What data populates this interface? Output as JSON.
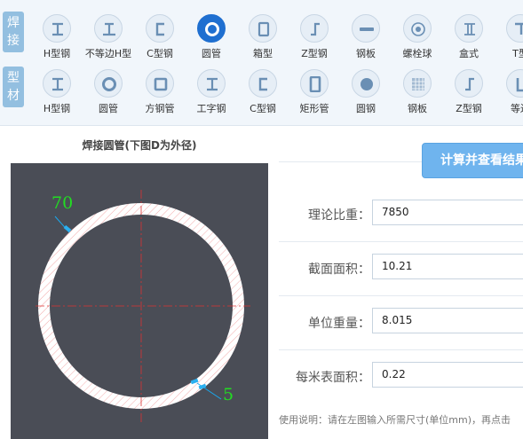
{
  "categories": {
    "welded": [
      "焊",
      "接"
    ],
    "profile": [
      "型",
      "材"
    ]
  },
  "welded_items": [
    {
      "name": "h-beam",
      "label": "H型钢",
      "icon": "i-beam-icon"
    },
    {
      "name": "unequal-h-beam",
      "label": "不等边H型",
      "icon": "unequal-i-beam-icon"
    },
    {
      "name": "c-channel",
      "label": "C型钢",
      "icon": "c-channel-icon"
    },
    {
      "name": "round-tube",
      "label": "圆管",
      "icon": "ring-icon",
      "active": true
    },
    {
      "name": "box-section",
      "label": "箱型",
      "icon": "box-icon"
    },
    {
      "name": "z-section",
      "label": "Z型钢",
      "icon": "z-section-icon"
    },
    {
      "name": "steel-plate",
      "label": "钢板",
      "icon": "plate-icon"
    },
    {
      "name": "bolt-ball",
      "label": "螺栓球",
      "icon": "ball-icon"
    },
    {
      "name": "box-type",
      "label": "盒式",
      "icon": "double-t-icon"
    },
    {
      "name": "t-section",
      "label": "T型",
      "icon": "t-section-icon"
    }
  ],
  "profile_items": [
    {
      "name": "h-beam",
      "label": "H型钢",
      "icon": "i-beam-icon"
    },
    {
      "name": "round-tube",
      "label": "圆管",
      "icon": "ring-icon"
    },
    {
      "name": "square-tube",
      "label": "方钢管",
      "icon": "square-tube-icon"
    },
    {
      "name": "i-beam",
      "label": "工字钢",
      "icon": "i-beam-icon"
    },
    {
      "name": "c-channel",
      "label": "C型钢",
      "icon": "c-channel-icon"
    },
    {
      "name": "rect-tube",
      "label": "矩形管",
      "icon": "rect-tube-icon"
    },
    {
      "name": "round-bar",
      "label": "圆钢",
      "icon": "solid-circle-icon"
    },
    {
      "name": "steel-plate",
      "label": "钢板",
      "icon": "checker-plate-icon"
    },
    {
      "name": "z-section",
      "label": "Z型钢",
      "icon": "z-section-icon"
    },
    {
      "name": "unequal-angle",
      "label": "等边",
      "icon": "angle-icon"
    }
  ],
  "diagram": {
    "title": "焊接圆管(下图D为外径)",
    "outer_diameter": "70",
    "thickness": "5"
  },
  "calc_button": "计算并查看结果",
  "fields": [
    {
      "name": "density",
      "label": "理论比重：",
      "value": "7850"
    },
    {
      "name": "section-area",
      "label": "截面面积：",
      "value": "10.21"
    },
    {
      "name": "unit-weight",
      "label": "单位重量：",
      "value": "8.015"
    },
    {
      "name": "surface-area",
      "label": "每米表面积：",
      "value": "0.22"
    }
  ],
  "usage_note": "使用说明：请在左图输入所需尺寸(单位mm)，再点击",
  "colors": {
    "accent": "#1f6fd0",
    "category_bg": "#93bfe0",
    "diagram_bg": "#4a4d56",
    "dimension_text": "#22dd22",
    "marker": "#2bb0f0"
  }
}
